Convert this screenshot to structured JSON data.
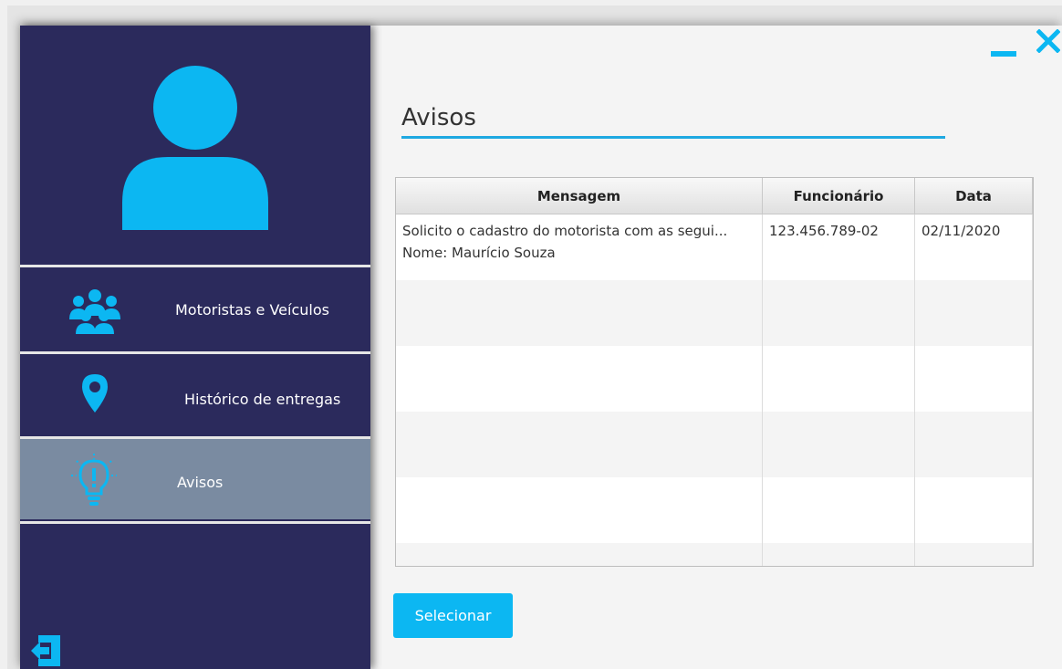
{
  "window": {
    "minimize_icon": "minimize-icon",
    "close_icon": "close-icon"
  },
  "sidebar": {
    "avatar_icon": "user-avatar-icon",
    "items": [
      {
        "label": "Motoristas e Veículos",
        "icon": "users-group-icon",
        "active": false
      },
      {
        "label": "Histórico de entregas",
        "icon": "map-pin-icon",
        "active": false
      },
      {
        "label": "Avisos",
        "icon": "lightbulb-alert-icon",
        "active": true
      }
    ],
    "back_icon": "logout-back-icon"
  },
  "main": {
    "title": "Avisos",
    "table": {
      "columns": [
        "Mensagem",
        "Funcionário",
        "Data"
      ],
      "rows": [
        {
          "mensagem_line1": "Solicito o cadastro do motorista com as segui...",
          "mensagem_line2": "Nome: Maurício Souza",
          "funcionario": "123.456.789-02",
          "data": "02/11/2020"
        }
      ]
    },
    "select_button": "Selecionar"
  },
  "colors": {
    "sidebar_bg": "#2b2a5c",
    "accent": "#0cb7f2",
    "active_item_bg": "#7a8ba1"
  }
}
